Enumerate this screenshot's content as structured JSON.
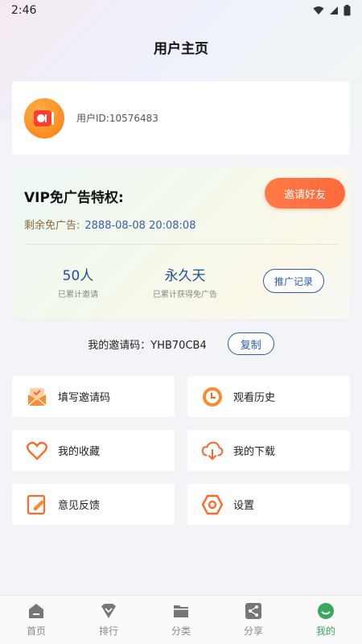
{
  "status_bar": {
    "time": "2:46"
  },
  "header": {
    "title": "用户主页"
  },
  "profile": {
    "user_id": "用户ID:10576483"
  },
  "vip": {
    "title": "VIP免广告特权:",
    "invite_button": "邀请好友",
    "remain_label": "剩余免广告:",
    "remain_value": "2888-08-08 20:08:08",
    "invited_count": "50人",
    "invited_label": "已累计邀请",
    "ad_free_value": "永久天",
    "ad_free_label": "已累计获得免广告",
    "promo_button": "推广记录"
  },
  "invite_code": {
    "label": "我的邀请码：YHB70CB4",
    "copy_button": "复制"
  },
  "menu": {
    "fill_code": "填写邀请码",
    "history": "观看历史",
    "favorites": "我的收藏",
    "downloads": "我的下载",
    "feedback": "意见反馈",
    "settings": "设置"
  },
  "tabs": [
    {
      "label": "首页",
      "icon": "home-icon"
    },
    {
      "label": "排行",
      "icon": "ranking-icon"
    },
    {
      "label": "分类",
      "icon": "folder-icon"
    },
    {
      "label": "分享",
      "icon": "share-icon"
    },
    {
      "label": "我的",
      "icon": "profile-icon",
      "active": true
    }
  ],
  "colors": {
    "accent": "#3aa85c",
    "orange": "#ff6a3d",
    "blue": "#2b5bb0",
    "background": "#f3f4f7"
  }
}
